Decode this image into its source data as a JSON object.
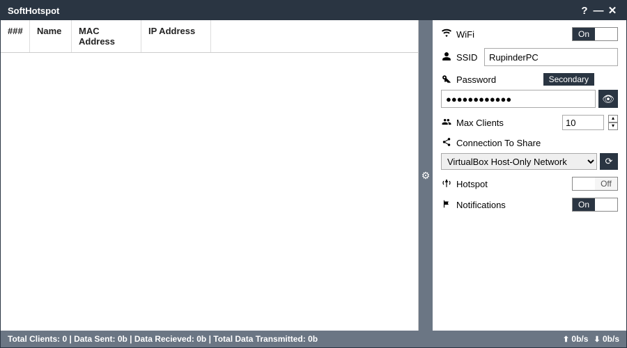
{
  "titlebar": {
    "title": "SoftHotspot"
  },
  "table": {
    "headers": [
      "###",
      "Name",
      "MAC Address",
      "IP Address"
    ]
  },
  "settings": {
    "wifi": {
      "label": "WiFi",
      "toggle": "On"
    },
    "ssid": {
      "label": "SSID",
      "value": "RupinderPC"
    },
    "password": {
      "label": "Password",
      "badge": "Secondary",
      "value": "●●●●●●●●●●●●"
    },
    "maxClients": {
      "label": "Max Clients",
      "value": "10"
    },
    "connection": {
      "label": "Connection To Share",
      "value": "VirtualBox Host-Only Network"
    },
    "hotspot": {
      "label": "Hotspot",
      "toggle": "Off"
    },
    "notifications": {
      "label": "Notifications",
      "toggle": "On"
    }
  },
  "status": {
    "text": "Total Clients: 0 | Data Sent: 0b | Data Recieved: 0b | Total Data Transmitted: 0b",
    "up": "0b/s",
    "down": "0b/s"
  }
}
